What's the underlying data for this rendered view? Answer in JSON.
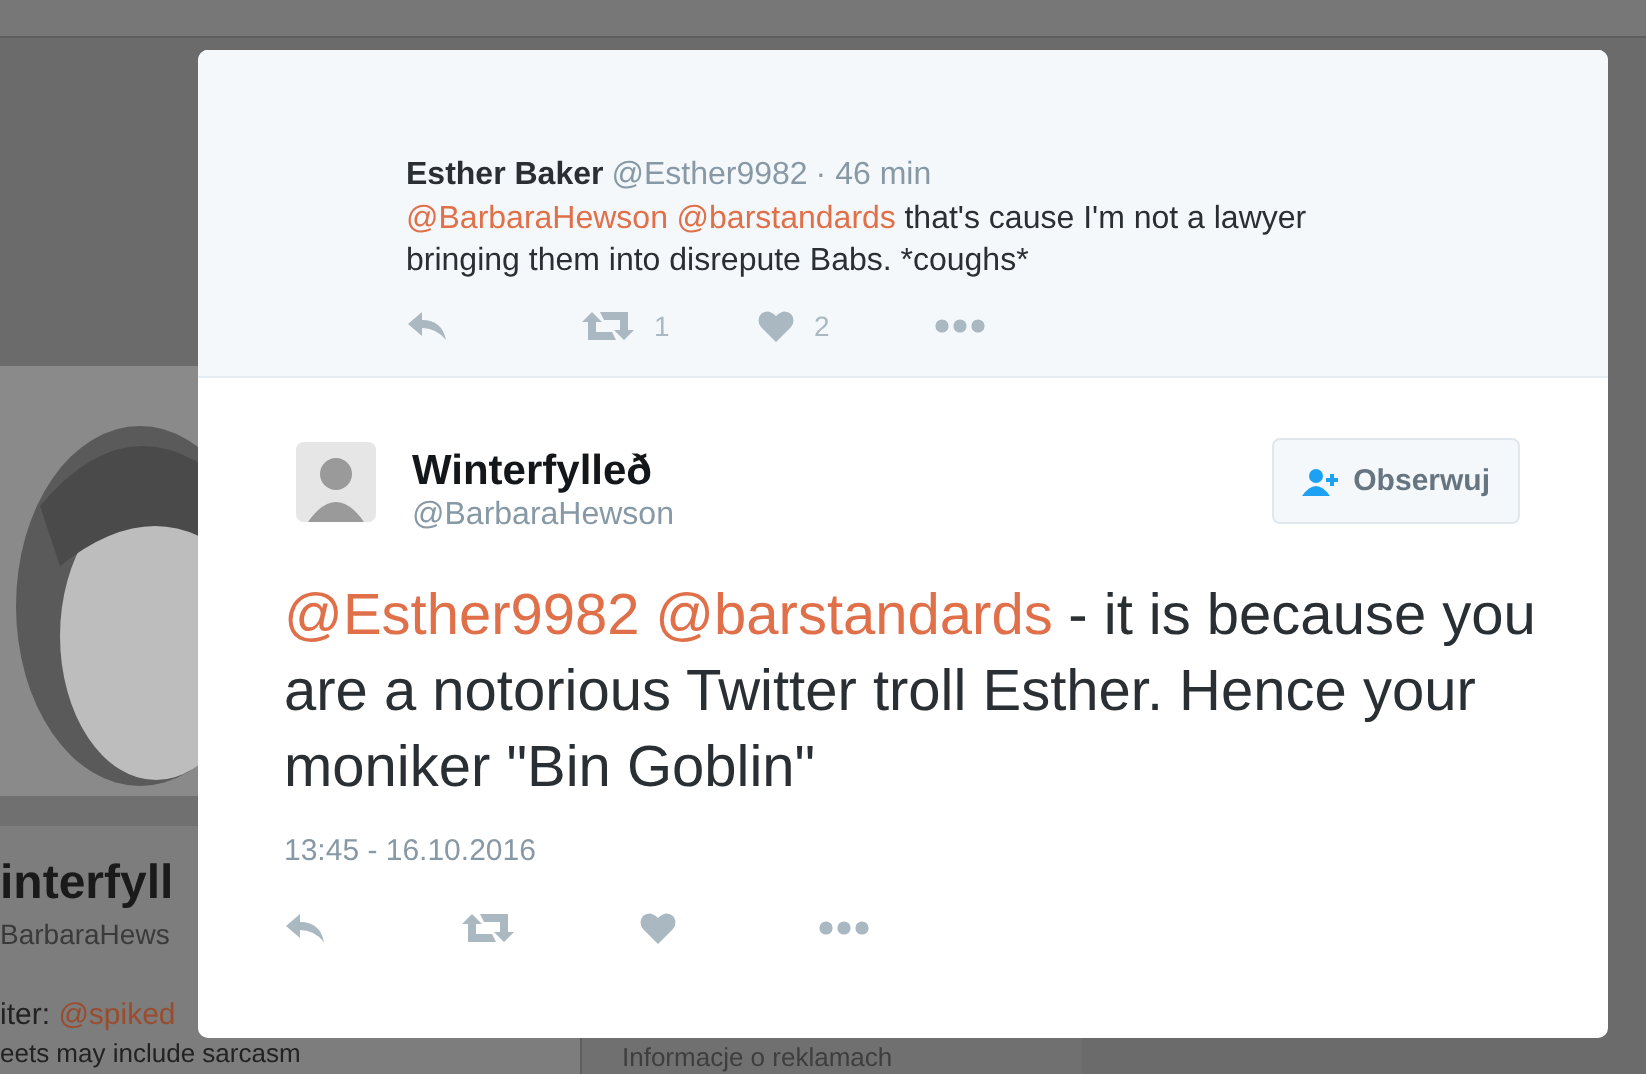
{
  "background_profile": {
    "name": "interfyll",
    "handle": "BarbaraHews",
    "bio_label": "iter:",
    "bio_link": "@spiked",
    "bio_line": "eets may include sarcasm"
  },
  "background_sidebar": {
    "link": "Informacje o reklamach"
  },
  "reply": {
    "name": "Esther Baker",
    "handle": "@Esther9982",
    "time": "· 46 min",
    "mentions": [
      "@BarbaraHewson",
      "@barstandards"
    ],
    "text": "that's cause I'm not a lawyer bringing them into disrepute Babs. *coughs*",
    "actions": [
      {
        "kind": "reply"
      },
      {
        "kind": "retweet",
        "count": "1"
      },
      {
        "kind": "like",
        "count": "2"
      },
      {
        "kind": "more"
      }
    ]
  },
  "tweet": {
    "name": "Winterfylleð",
    "handle": "@BarbaraHewson",
    "follow_button": "Obserwuj",
    "mentions": [
      "@Esther9982",
      "@barstandards"
    ],
    "text": "- it is because you are a notorious Twitter troll Esther. Hence your moniker \"Bin Goblin\"",
    "timestamp": "13:45 - 16.10.2016",
    "actions": [
      {
        "kind": "reply"
      },
      {
        "kind": "retweet"
      },
      {
        "kind": "like"
      },
      {
        "kind": "more"
      }
    ]
  }
}
